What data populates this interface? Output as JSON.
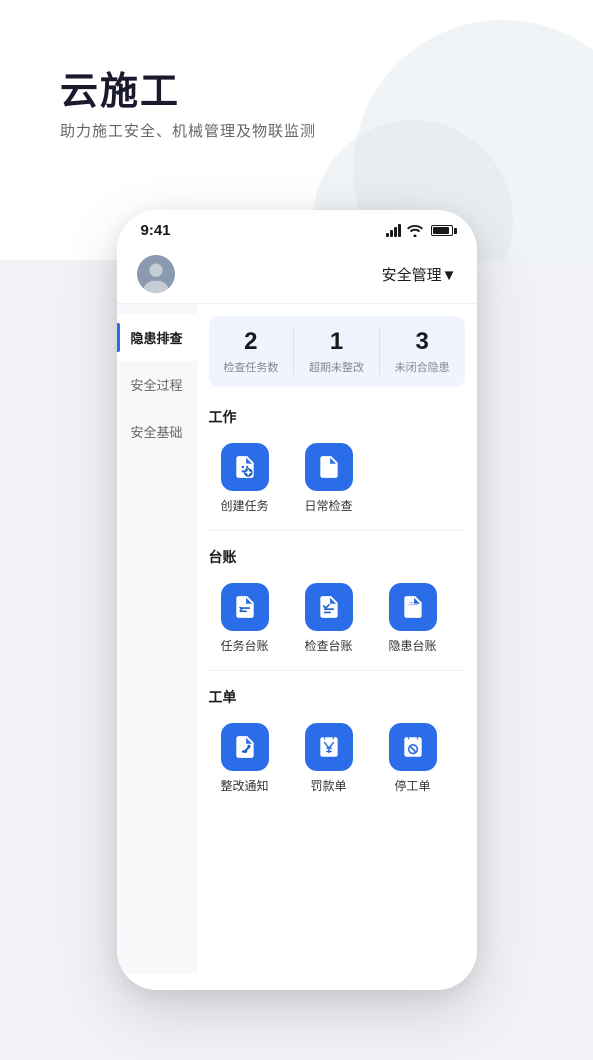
{
  "hero": {
    "title": "云施工",
    "subtitle": "助力施工安全、机械管理及物联监测"
  },
  "statusBar": {
    "time": "9:41"
  },
  "header": {
    "role": "安全管理▼"
  },
  "sidebar": {
    "items": [
      {
        "label": "隐患排查",
        "active": true
      },
      {
        "label": "安全过程",
        "active": false
      },
      {
        "label": "安全基础",
        "active": false
      }
    ]
  },
  "stats": [
    {
      "number": "2",
      "label": "检查任务数"
    },
    {
      "number": "1",
      "label": "超期未整改"
    },
    {
      "number": "3",
      "label": "未闭合隐患"
    }
  ],
  "sections": [
    {
      "title": "工作",
      "items": [
        {
          "label": "创建任务",
          "icon": "plus-doc"
        },
        {
          "label": "日常检查",
          "icon": "search-doc"
        }
      ]
    },
    {
      "title": "台账",
      "items": [
        {
          "label": "任务台账",
          "icon": "list-doc"
        },
        {
          "label": "检查台账",
          "icon": "check-doc"
        },
        {
          "label": "隐患台账",
          "icon": "warning-doc"
        }
      ]
    },
    {
      "title": "工单",
      "items": [
        {
          "label": "整改通知",
          "icon": "wrench"
        },
        {
          "label": "罚款单",
          "icon": "yen"
        },
        {
          "label": "停工单",
          "icon": "stop"
        }
      ]
    }
  ],
  "colors": {
    "accent": "#2b6de8",
    "background": "#f0f2f5",
    "sidebar_bg": "#f7f8fa"
  }
}
